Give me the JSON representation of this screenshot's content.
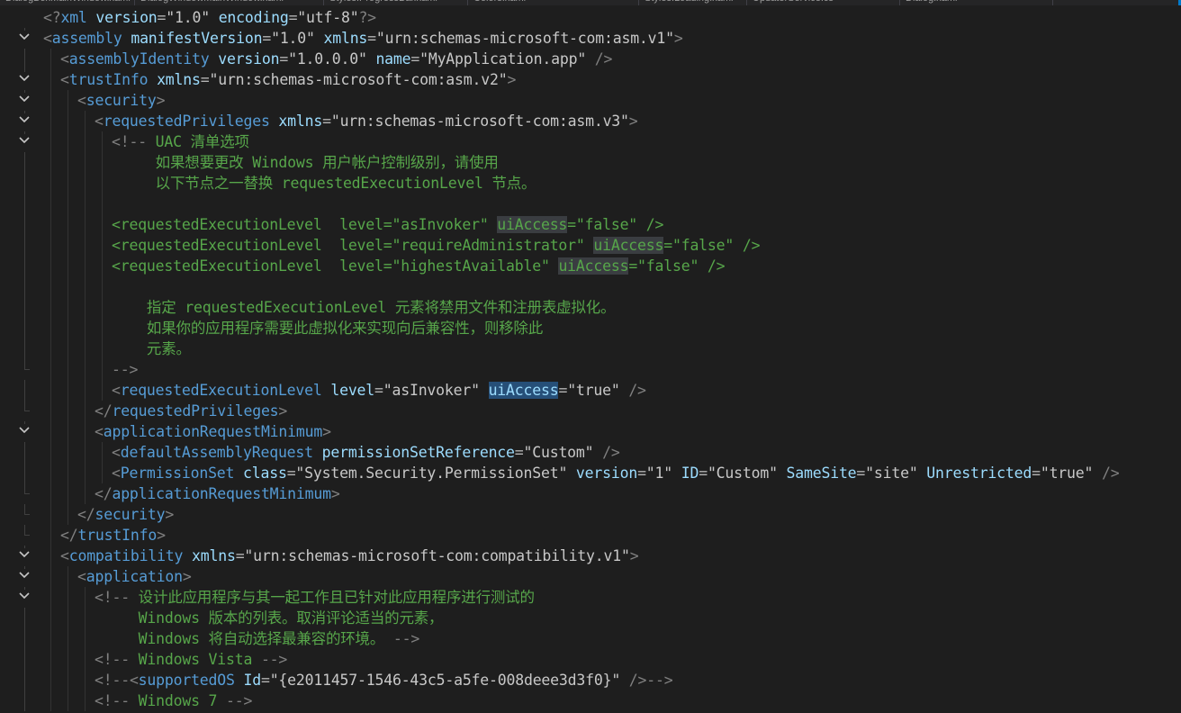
{
  "tabs": [
    {
      "label": "DialogBoxMainWindow.xaml"
    },
    {
      "label": "DialogWindowMainWindow.xaml"
    },
    {
      "label": "Styles.ProgressBar.xaml"
    },
    {
      "label": "Colors.xaml"
    },
    {
      "label": "Styles.Loading.xaml"
    },
    {
      "label": "UpdaterService.cs"
    },
    {
      "label": "Dialog.xaml"
    }
  ],
  "code_lines": [
    {
      "fold": "none",
      "indent": 0,
      "tokens": [
        {
          "t": "br",
          "v": "<?"
        },
        {
          "t": "tag",
          "v": "xml"
        },
        {
          "t": "sp",
          "v": " "
        },
        {
          "t": "at",
          "v": "version"
        },
        {
          "t": "eq",
          "v": "="
        },
        {
          "t": "q",
          "v": "\""
        },
        {
          "t": "val",
          "v": "1.0"
        },
        {
          "t": "q",
          "v": "\""
        },
        {
          "t": "sp",
          "v": " "
        },
        {
          "t": "at",
          "v": "encoding"
        },
        {
          "t": "eq",
          "v": "="
        },
        {
          "t": "q",
          "v": "\""
        },
        {
          "t": "val",
          "v": "utf-8"
        },
        {
          "t": "q",
          "v": "\""
        },
        {
          "t": "br",
          "v": "?>"
        }
      ]
    },
    {
      "fold": "open",
      "indent": 0,
      "tokens": [
        {
          "t": "br",
          "v": "<"
        },
        {
          "t": "tag",
          "v": "assembly"
        },
        {
          "t": "sp",
          "v": " "
        },
        {
          "t": "at",
          "v": "manifestVersion"
        },
        {
          "t": "eq",
          "v": "="
        },
        {
          "t": "q",
          "v": "\""
        },
        {
          "t": "val",
          "v": "1.0"
        },
        {
          "t": "q",
          "v": "\""
        },
        {
          "t": "sp",
          "v": " "
        },
        {
          "t": "at",
          "v": "xmlns"
        },
        {
          "t": "eq",
          "v": "="
        },
        {
          "t": "q",
          "v": "\""
        },
        {
          "t": "val",
          "v": "urn:schemas-microsoft-com:asm.v1"
        },
        {
          "t": "q",
          "v": "\""
        },
        {
          "t": "br",
          "v": ">"
        }
      ]
    },
    {
      "fold": "none",
      "indent": 1,
      "tokens": [
        {
          "t": "br",
          "v": "<"
        },
        {
          "t": "tag",
          "v": "assemblyIdentity"
        },
        {
          "t": "sp",
          "v": " "
        },
        {
          "t": "at",
          "v": "version"
        },
        {
          "t": "eq",
          "v": "="
        },
        {
          "t": "q",
          "v": "\""
        },
        {
          "t": "val",
          "v": "1.0.0.0"
        },
        {
          "t": "q",
          "v": "\""
        },
        {
          "t": "sp",
          "v": " "
        },
        {
          "t": "at",
          "v": "name"
        },
        {
          "t": "eq",
          "v": "="
        },
        {
          "t": "q",
          "v": "\""
        },
        {
          "t": "val",
          "v": "MyApplication.app"
        },
        {
          "t": "q",
          "v": "\""
        },
        {
          "t": "sp",
          "v": " "
        },
        {
          "t": "br",
          "v": "/>"
        }
      ]
    },
    {
      "fold": "open",
      "indent": 1,
      "tokens": [
        {
          "t": "br",
          "v": "<"
        },
        {
          "t": "tag",
          "v": "trustInfo"
        },
        {
          "t": "sp",
          "v": " "
        },
        {
          "t": "at",
          "v": "xmlns"
        },
        {
          "t": "eq",
          "v": "="
        },
        {
          "t": "q",
          "v": "\""
        },
        {
          "t": "val",
          "v": "urn:schemas-microsoft-com:asm.v2"
        },
        {
          "t": "q",
          "v": "\""
        },
        {
          "t": "br",
          "v": ">"
        }
      ]
    },
    {
      "fold": "open",
      "indent": 2,
      "tokens": [
        {
          "t": "br",
          "v": "<"
        },
        {
          "t": "tag",
          "v": "security"
        },
        {
          "t": "br",
          "v": ">"
        }
      ]
    },
    {
      "fold": "open",
      "indent": 3,
      "tokens": [
        {
          "t": "br",
          "v": "<"
        },
        {
          "t": "tag",
          "v": "requestedPrivileges"
        },
        {
          "t": "sp",
          "v": " "
        },
        {
          "t": "at",
          "v": "xmlns"
        },
        {
          "t": "eq",
          "v": "="
        },
        {
          "t": "q",
          "v": "\""
        },
        {
          "t": "val",
          "v": "urn:schemas-microsoft-com:asm.v3"
        },
        {
          "t": "q",
          "v": "\""
        },
        {
          "t": "br",
          "v": ">"
        }
      ]
    },
    {
      "fold": "open",
      "indent": 4,
      "tokens": [
        {
          "t": "br",
          "v": "<!--"
        },
        {
          "t": "cm",
          "v": " UAC 清单选项"
        }
      ]
    },
    {
      "fold": "none",
      "indent": 4,
      "tokens": [
        {
          "t": "cm",
          "v": "     如果想要更改 Windows 用户帐户控制级别，请使用"
        }
      ]
    },
    {
      "fold": "none",
      "indent": 4,
      "tokens": [
        {
          "t": "cm",
          "v": "     以下节点之一替换 requestedExecutionLevel 节点。"
        }
      ]
    },
    {
      "fold": "none",
      "indent": 4,
      "tokens": []
    },
    {
      "fold": "none",
      "indent": 4,
      "tokens": [
        {
          "t": "cm",
          "v": "<requestedExecutionLevel  level=\"asInvoker\" "
        },
        {
          "t": "cmhl",
          "v": "uiAccess"
        },
        {
          "t": "cm",
          "v": "=\"false\" />"
        }
      ]
    },
    {
      "fold": "none",
      "indent": 4,
      "tokens": [
        {
          "t": "cm",
          "v": "<requestedExecutionLevel  level=\"requireAdministrator\" "
        },
        {
          "t": "cmhl",
          "v": "uiAccess"
        },
        {
          "t": "cm",
          "v": "=\"false\" />"
        }
      ]
    },
    {
      "fold": "none",
      "indent": 4,
      "tokens": [
        {
          "t": "cm",
          "v": "<requestedExecutionLevel  level=\"highestAvailable\" "
        },
        {
          "t": "cmhl",
          "v": "uiAccess"
        },
        {
          "t": "cm",
          "v": "=\"false\" />"
        }
      ]
    },
    {
      "fold": "none",
      "indent": 4,
      "tokens": []
    },
    {
      "fold": "none",
      "indent": 4,
      "tokens": [
        {
          "t": "cm",
          "v": "    指定 requestedExecutionLevel 元素将禁用文件和注册表虚拟化。"
        }
      ]
    },
    {
      "fold": "none",
      "indent": 4,
      "tokens": [
        {
          "t": "cm",
          "v": "    如果你的应用程序需要此虚拟化来实现向后兼容性，则移除此"
        }
      ]
    },
    {
      "fold": "none",
      "indent": 4,
      "tokens": [
        {
          "t": "cm",
          "v": "    元素。"
        }
      ]
    },
    {
      "fold": "end",
      "indent": 4,
      "tokens": [
        {
          "t": "br",
          "v": "-->"
        }
      ]
    },
    {
      "fold": "none",
      "indent": 4,
      "tokens": [
        {
          "t": "br",
          "v": "<"
        },
        {
          "t": "tag",
          "v": "requestedExecutionLevel"
        },
        {
          "t": "sp",
          "v": " "
        },
        {
          "t": "at",
          "v": "level"
        },
        {
          "t": "eq",
          "v": "="
        },
        {
          "t": "q",
          "v": "\""
        },
        {
          "t": "val",
          "v": "asInvoker"
        },
        {
          "t": "q",
          "v": "\""
        },
        {
          "t": "sp",
          "v": " "
        },
        {
          "t": "sel",
          "v": "uiAccess"
        },
        {
          "t": "eq",
          "v": "="
        },
        {
          "t": "q",
          "v": "\""
        },
        {
          "t": "val",
          "v": "true"
        },
        {
          "t": "q",
          "v": "\""
        },
        {
          "t": "sp",
          "v": " "
        },
        {
          "t": "br",
          "v": "/>"
        }
      ]
    },
    {
      "fold": "end",
      "indent": 3,
      "tokens": [
        {
          "t": "br",
          "v": "</"
        },
        {
          "t": "tag",
          "v": "requestedPrivileges"
        },
        {
          "t": "br",
          "v": ">"
        }
      ]
    },
    {
      "fold": "open",
      "indent": 3,
      "tokens": [
        {
          "t": "br",
          "v": "<"
        },
        {
          "t": "tag",
          "v": "applicationRequestMinimum"
        },
        {
          "t": "br",
          "v": ">"
        }
      ]
    },
    {
      "fold": "none",
      "indent": 4,
      "tokens": [
        {
          "t": "br",
          "v": "<"
        },
        {
          "t": "tag",
          "v": "defaultAssemblyRequest"
        },
        {
          "t": "sp",
          "v": " "
        },
        {
          "t": "at",
          "v": "permissionSetReference"
        },
        {
          "t": "eq",
          "v": "="
        },
        {
          "t": "q",
          "v": "\""
        },
        {
          "t": "val",
          "v": "Custom"
        },
        {
          "t": "q",
          "v": "\""
        },
        {
          "t": "sp",
          "v": " "
        },
        {
          "t": "br",
          "v": "/>"
        }
      ]
    },
    {
      "fold": "none",
      "indent": 4,
      "tokens": [
        {
          "t": "br",
          "v": "<"
        },
        {
          "t": "tag",
          "v": "PermissionSet"
        },
        {
          "t": "sp",
          "v": " "
        },
        {
          "t": "at",
          "v": "class"
        },
        {
          "t": "eq",
          "v": "="
        },
        {
          "t": "q",
          "v": "\""
        },
        {
          "t": "val",
          "v": "System.Security.PermissionSet"
        },
        {
          "t": "q",
          "v": "\""
        },
        {
          "t": "sp",
          "v": " "
        },
        {
          "t": "at",
          "v": "version"
        },
        {
          "t": "eq",
          "v": "="
        },
        {
          "t": "q",
          "v": "\""
        },
        {
          "t": "val",
          "v": "1"
        },
        {
          "t": "q",
          "v": "\""
        },
        {
          "t": "sp",
          "v": " "
        },
        {
          "t": "at",
          "v": "ID"
        },
        {
          "t": "eq",
          "v": "="
        },
        {
          "t": "q",
          "v": "\""
        },
        {
          "t": "val",
          "v": "Custom"
        },
        {
          "t": "q",
          "v": "\""
        },
        {
          "t": "sp",
          "v": " "
        },
        {
          "t": "at",
          "v": "SameSite"
        },
        {
          "t": "eq",
          "v": "="
        },
        {
          "t": "q",
          "v": "\""
        },
        {
          "t": "val",
          "v": "site"
        },
        {
          "t": "q",
          "v": "\""
        },
        {
          "t": "sp",
          "v": " "
        },
        {
          "t": "at",
          "v": "Unrestricted"
        },
        {
          "t": "eq",
          "v": "="
        },
        {
          "t": "q",
          "v": "\""
        },
        {
          "t": "val",
          "v": "true"
        },
        {
          "t": "q",
          "v": "\""
        },
        {
          "t": "sp",
          "v": " "
        },
        {
          "t": "br",
          "v": "/>"
        }
      ]
    },
    {
      "fold": "end",
      "indent": 3,
      "tokens": [
        {
          "t": "br",
          "v": "</"
        },
        {
          "t": "tag",
          "v": "applicationRequestMinimum"
        },
        {
          "t": "br",
          "v": ">"
        }
      ]
    },
    {
      "fold": "end",
      "indent": 2,
      "tokens": [
        {
          "t": "br",
          "v": "</"
        },
        {
          "t": "tag",
          "v": "security"
        },
        {
          "t": "br",
          "v": ">"
        }
      ]
    },
    {
      "fold": "end",
      "indent": 1,
      "tokens": [
        {
          "t": "br",
          "v": "</"
        },
        {
          "t": "tag",
          "v": "trustInfo"
        },
        {
          "t": "br",
          "v": ">"
        }
      ]
    },
    {
      "fold": "open",
      "indent": 1,
      "tokens": [
        {
          "t": "br",
          "v": "<"
        },
        {
          "t": "tag",
          "v": "compatibility"
        },
        {
          "t": "sp",
          "v": " "
        },
        {
          "t": "at",
          "v": "xmlns"
        },
        {
          "t": "eq",
          "v": "="
        },
        {
          "t": "q",
          "v": "\""
        },
        {
          "t": "val",
          "v": "urn:schemas-microsoft-com:compatibility.v1"
        },
        {
          "t": "q",
          "v": "\""
        },
        {
          "t": "br",
          "v": ">"
        }
      ]
    },
    {
      "fold": "open",
      "indent": 2,
      "tokens": [
        {
          "t": "br",
          "v": "<"
        },
        {
          "t": "tag",
          "v": "application"
        },
        {
          "t": "br",
          "v": ">"
        }
      ]
    },
    {
      "fold": "open",
      "indent": 3,
      "tokens": [
        {
          "t": "br",
          "v": "<!--"
        },
        {
          "t": "cm",
          "v": " 设计此应用程序与其一起工作且已针对此应用程序进行测试的"
        }
      ]
    },
    {
      "fold": "none",
      "indent": 3,
      "tokens": [
        {
          "t": "cm",
          "v": "     Windows 版本的列表。取消评论适当的元素，"
        }
      ]
    },
    {
      "fold": "none",
      "indent": 3,
      "tokens": [
        {
          "t": "cm",
          "v": "     Windows 将自动选择最兼容的环境。 "
        },
        {
          "t": "br",
          "v": "-->"
        }
      ]
    },
    {
      "fold": "none",
      "indent": 3,
      "tokens": [
        {
          "t": "br",
          "v": "<!--"
        },
        {
          "t": "cm",
          "v": " Windows Vista "
        },
        {
          "t": "br",
          "v": "-->"
        }
      ]
    },
    {
      "fold": "none",
      "indent": 3,
      "tokens": [
        {
          "t": "br",
          "v": "<!--"
        },
        {
          "t": "br",
          "v": "<"
        },
        {
          "t": "tag",
          "v": "supportedOS"
        },
        {
          "t": "sp",
          "v": " "
        },
        {
          "t": "at",
          "v": "Id"
        },
        {
          "t": "eq",
          "v": "="
        },
        {
          "t": "q",
          "v": "\""
        },
        {
          "t": "val",
          "v": "{e2011457-1546-43c5-a5fe-008deee3d3f0}"
        },
        {
          "t": "q",
          "v": "\""
        },
        {
          "t": "sp",
          "v": " "
        },
        {
          "t": "br",
          "v": "/>-->"
        }
      ]
    },
    {
      "fold": "none",
      "indent": 3,
      "tokens": [
        {
          "t": "br",
          "v": "<!--"
        },
        {
          "t": "cm",
          "v": " Windows 7 "
        },
        {
          "t": "br",
          "v": "-->"
        }
      ]
    }
  ]
}
